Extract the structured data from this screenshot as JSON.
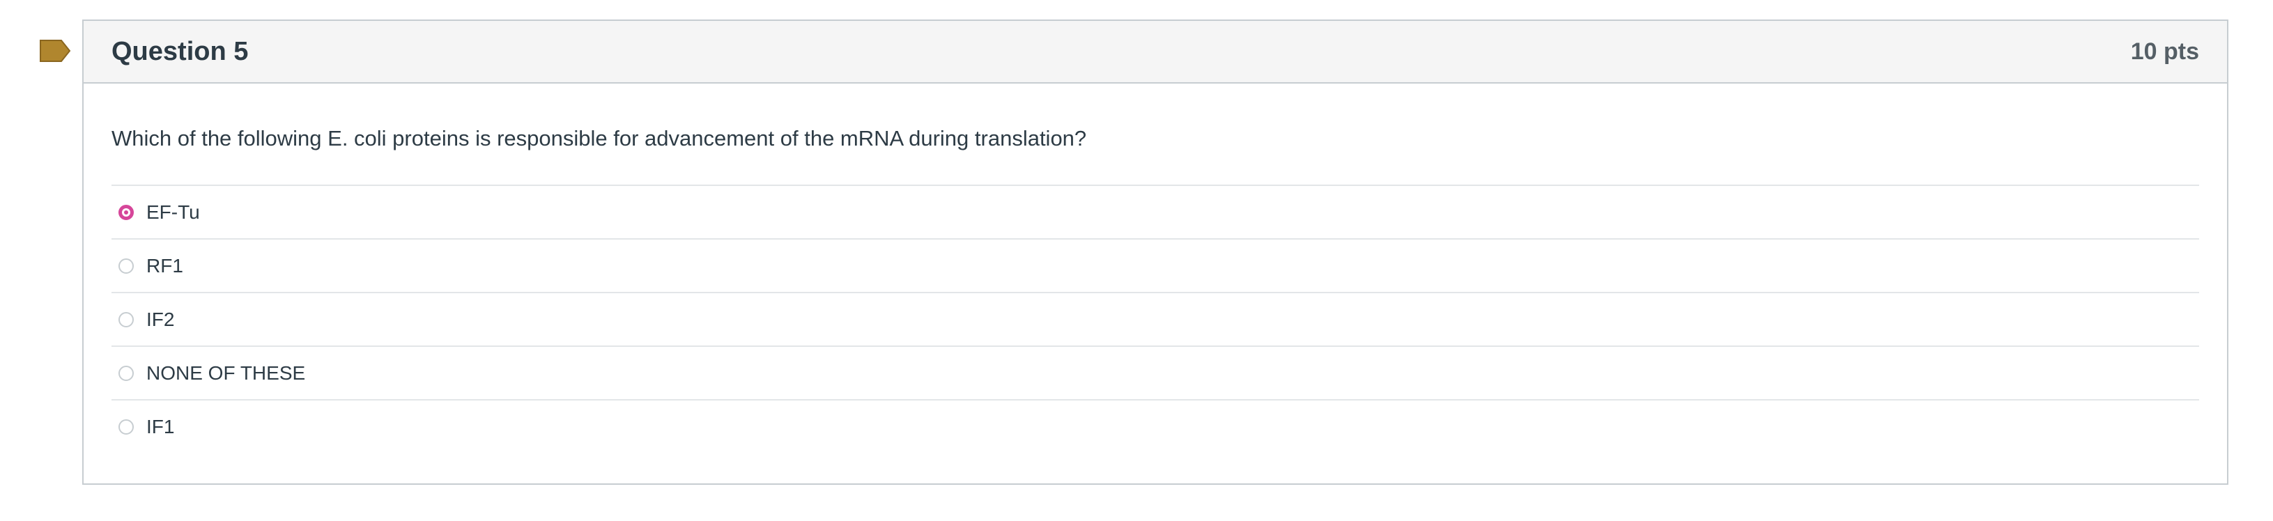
{
  "question": {
    "title": "Question 5",
    "points": "10 pts",
    "text": "Which of the following E. coli proteins is responsible for advancement of the mRNA during translation?",
    "flag_color": "#b0862e",
    "accent_color": "#d6469a",
    "answers": [
      {
        "label": "EF-Tu",
        "selected": true
      },
      {
        "label": "RF1",
        "selected": false
      },
      {
        "label": "IF2",
        "selected": false
      },
      {
        "label": "NONE OF THESE",
        "selected": false
      },
      {
        "label": "IF1",
        "selected": false
      }
    ]
  }
}
